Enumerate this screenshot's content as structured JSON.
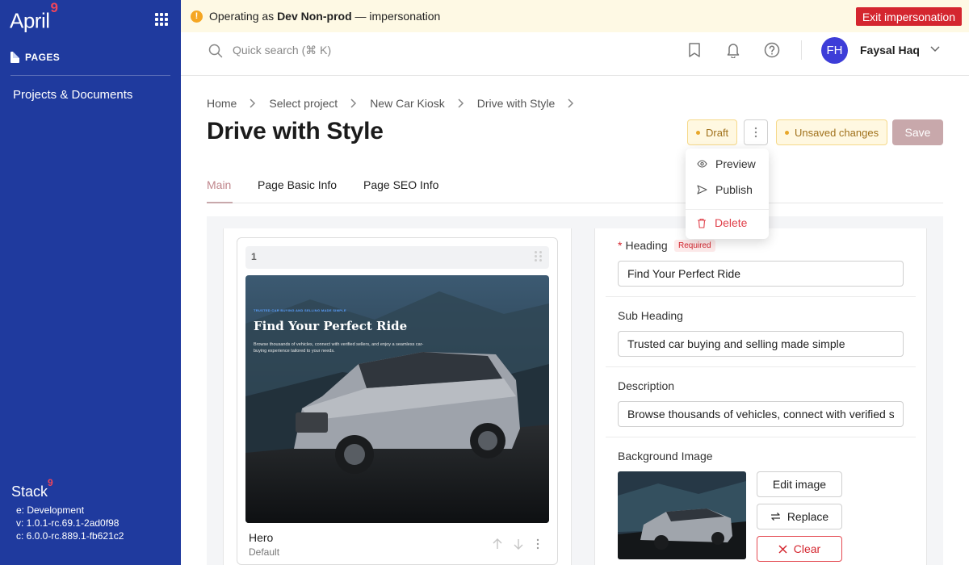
{
  "sidebar": {
    "logo_text": "April",
    "logo_mark": "9",
    "section_label": "PAGES",
    "nav_item": "Projects & Documents",
    "stack_logo_text": "Stack",
    "stack_logo_mark": "9",
    "env_line": "e: Development",
    "version_line": "v: 1.0.1-rc.69.1-2ad0f98",
    "core_line": "c: 6.0.0-rc.889.1-fb621c2"
  },
  "banner": {
    "prefix": "Operating as",
    "org": "Dev Non-prod",
    "suffix": "— impersonation",
    "exit_label": "Exit impersonation"
  },
  "topbar": {
    "search_placeholder": "Quick search (⌘ K)",
    "user_initials": "FH",
    "user_name": "Faysal Haq"
  },
  "breadcrumb": [
    "Home",
    "Select project",
    "New Car Kiosk",
    "Drive with Style"
  ],
  "page_title": "Drive with Style",
  "status": {
    "draft_label": "Draft",
    "unsaved_label": "Unsaved changes",
    "save_label": "Save"
  },
  "menu": {
    "preview": "Preview",
    "publish": "Publish",
    "delete": "Delete"
  },
  "tabs": [
    "Main",
    "Page Basic Info",
    "Page SEO Info"
  ],
  "block": {
    "index": "1",
    "name": "Hero",
    "variant": "Default",
    "preview_tag": "TRUSTED CAR BUYING AND SELLING MADE SIMPLE",
    "preview_title": "Find Your Perfect Ride",
    "preview_desc": "Browse thousands of vehicles, connect with verified sellers, and enjoy a seamless car-buying experience tailored to your needs."
  },
  "form": {
    "heading_label": "Heading",
    "required_label": "Required",
    "heading_value": "Find Your Perfect Ride",
    "subheading_label": "Sub Heading",
    "subheading_value": "Trusted car buying and selling made simple",
    "description_label": "Description",
    "description_value": "Browse thousands of vehicles, connect with verified sellers",
    "bgimage_label": "Background Image",
    "edit_image_label": "Edit image",
    "replace_label": "Replace",
    "clear_label": "Clear"
  },
  "colors": {
    "sidebar": "#1f3a9e",
    "danger": "#d4262f",
    "banner": "#fef9e4",
    "draft": "#fff8e1",
    "save_disabled": "#c8a8ab",
    "avatar": "#3d3dd8"
  }
}
